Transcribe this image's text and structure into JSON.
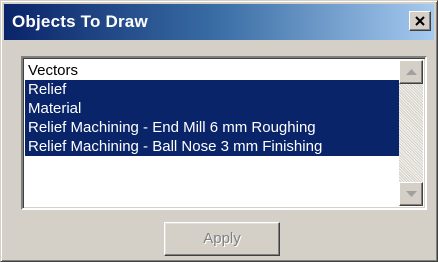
{
  "window": {
    "title": "Objects To Draw",
    "close_label": "close"
  },
  "list": {
    "items": [
      {
        "label": "Vectors",
        "selected": false
      },
      {
        "label": "Relief",
        "selected": true
      },
      {
        "label": "Material",
        "selected": true
      },
      {
        "label": "Relief Machining - End Mill 6 mm Roughing",
        "selected": true
      },
      {
        "label": "Relief Machining - Ball Nose 3 mm Finishing",
        "selected": true
      }
    ]
  },
  "buttons": {
    "apply_label": "Apply",
    "apply_enabled": false
  },
  "icons": {
    "close": "close-icon",
    "scroll_up": "arrow-up-icon",
    "scroll_down": "arrow-down-icon"
  },
  "colors": {
    "title_bar_start": "#0a246a",
    "title_bar_end": "#a6caf0",
    "selection": "#0a246a",
    "face": "#d4d0c8"
  }
}
